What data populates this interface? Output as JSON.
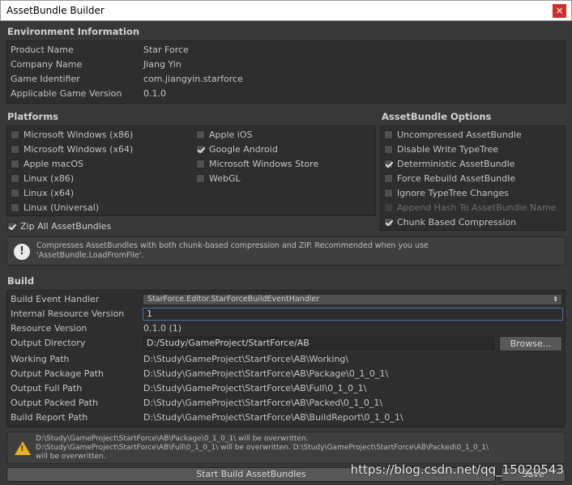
{
  "window": {
    "title": "AssetBundle Builder",
    "close_glyph": "×"
  },
  "environment": {
    "title": "Environment Information",
    "rows": [
      {
        "label": "Product Name",
        "value": "Star Force"
      },
      {
        "label": "Company Name",
        "value": "Jiang Yin"
      },
      {
        "label": "Game Identifier",
        "value": "com.jiangyin.starforce"
      },
      {
        "label": "Applicable Game Version",
        "value": "0.1.0"
      }
    ]
  },
  "platforms": {
    "title": "Platforms",
    "left": [
      {
        "label": "Microsoft Windows (x86)",
        "checked": false
      },
      {
        "label": "Microsoft Windows (x64)",
        "checked": false
      },
      {
        "label": "Apple macOS",
        "checked": false
      },
      {
        "label": "Linux (x86)",
        "checked": false
      },
      {
        "label": "Linux (x64)",
        "checked": false
      },
      {
        "label": "Linux (Universal)",
        "checked": false
      }
    ],
    "right": [
      {
        "label": "Apple iOS",
        "checked": false
      },
      {
        "label": "Google Android",
        "checked": true
      },
      {
        "label": "Microsoft Windows Store",
        "checked": false
      },
      {
        "label": "WebGL",
        "checked": false
      }
    ]
  },
  "options": {
    "title": "AssetBundle Options",
    "items": [
      {
        "label": "Uncompressed AssetBundle",
        "checked": false,
        "disabled": false
      },
      {
        "label": "Disable Write TypeTree",
        "checked": false,
        "disabled": false
      },
      {
        "label": "Deterministic AssetBundle",
        "checked": true,
        "disabled": false
      },
      {
        "label": "Force Rebuild AssetBundle",
        "checked": false,
        "disabled": false
      },
      {
        "label": "Ignore TypeTree Changes",
        "checked": false,
        "disabled": false
      },
      {
        "label": "Append Hash To AssetBundle Name",
        "checked": false,
        "disabled": true
      },
      {
        "label": "Chunk Based Compression",
        "checked": true,
        "disabled": false
      }
    ]
  },
  "zip": {
    "label": "Zip All AssetBundles",
    "checked": true,
    "help_line1": "Compresses AssetBundles with both chunk-based compression and ZIP. Recommended when you use",
    "help_line2": "'AssetBundle.LoadFromFile'.",
    "icon": "info-icon"
  },
  "build": {
    "title": "Build",
    "event_handler_label": "Build Event Handler",
    "event_handler_value": "StarForce.Editor.StarForceBuildEventHandler",
    "internal_version_label": "Internal Resource Version",
    "internal_version_value": "1",
    "resource_version_label": "Resource Version",
    "resource_version_value": "0.1.0 (1)",
    "output_directory_label": "Output Directory",
    "output_directory_value": "D:/Study/GameProject/StartForce/AB",
    "browse_label": "Browse...",
    "paths": [
      {
        "label": "Working Path",
        "value": "D:\\Study\\GameProject\\StartForce\\AB\\Working\\"
      },
      {
        "label": "Output Package Path",
        "value": "D:\\Study\\GameProject\\StartForce\\AB\\Package\\0_1_0_1\\"
      },
      {
        "label": "Output Full Path",
        "value": "D:\\Study\\GameProject\\StartForce\\AB\\Full\\0_1_0_1\\"
      },
      {
        "label": "Output Packed Path",
        "value": "D:\\Study\\GameProject\\StartForce\\AB\\Packed\\0_1_0_1\\"
      },
      {
        "label": "Build Report Path",
        "value": "D:\\Study\\GameProject\\StartForce\\AB\\BuildReport\\0_1_0_1\\"
      }
    ]
  },
  "warning": {
    "line1": "D:\\Study\\GameProject\\StartForce\\AB\\Package\\0_1_0_1\\ will be overwritten.",
    "line2": "D:\\Study\\GameProject\\StartForce\\AB\\Full\\0_1_0_1\\ will be overwritten. D:\\Study\\GameProject\\StartForce\\AB\\Packed\\0_1_0_1\\",
    "line3": "will be overwritten.",
    "icon": "warning-icon"
  },
  "actions": {
    "start_build_label": "Start Build AssetBundles",
    "save_label": "Save"
  },
  "watermark": "https://blog.csdn.net/qq_15020543",
  "colors": {
    "background": "#383838",
    "panel": "#2e2e2e",
    "focus": "#4a6fb5",
    "warning": "#e9b123",
    "close": "#c9302c"
  }
}
